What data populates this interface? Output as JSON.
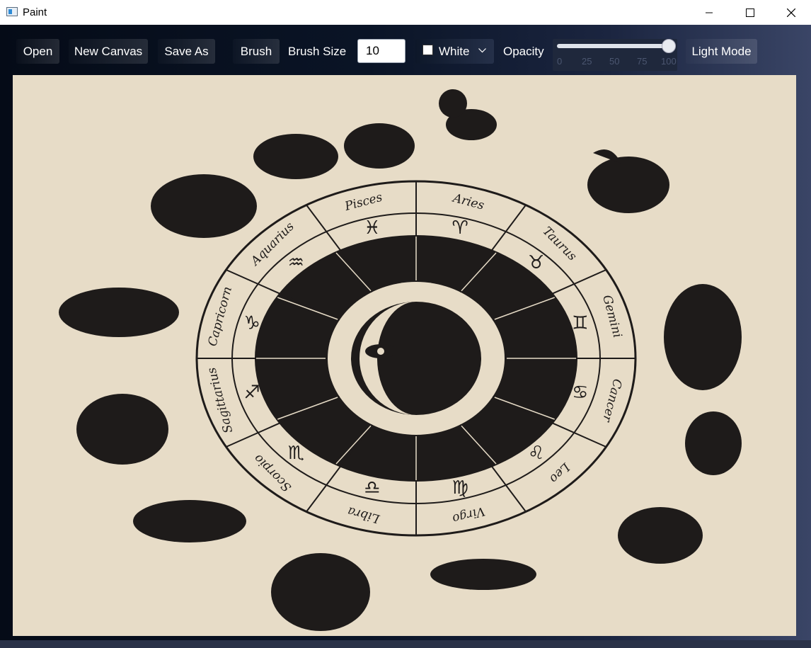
{
  "window": {
    "title": "Paint"
  },
  "toolbar": {
    "open_label": "Open",
    "new_canvas_label": "New Canvas",
    "save_as_label": "Save As",
    "brush_label": "Brush",
    "brush_size_label": "Brush Size",
    "brush_size_value": "10",
    "color_value": "White",
    "opacity_label": "Opacity",
    "opacity_value": 100,
    "opacity_ticks": [
      "0",
      "25",
      "50",
      "75",
      "100"
    ],
    "mode_label": "Light Mode"
  },
  "canvas": {
    "background": "#e7dcc7",
    "ink": "#1e1b1a",
    "zodiac_names": [
      "Aries",
      "Taurus",
      "Gemini",
      "Cancer",
      "Leo",
      "Virgo",
      "Libra",
      "Scorpio",
      "Sagittarius",
      "Capricorn",
      "Aquarius",
      "Pisces"
    ],
    "zodiac_symbols": [
      "♈",
      "♉",
      "♊",
      "♋",
      "♌",
      "♍",
      "♎",
      "♏",
      "♐",
      "♑",
      "♒",
      "♓"
    ]
  }
}
